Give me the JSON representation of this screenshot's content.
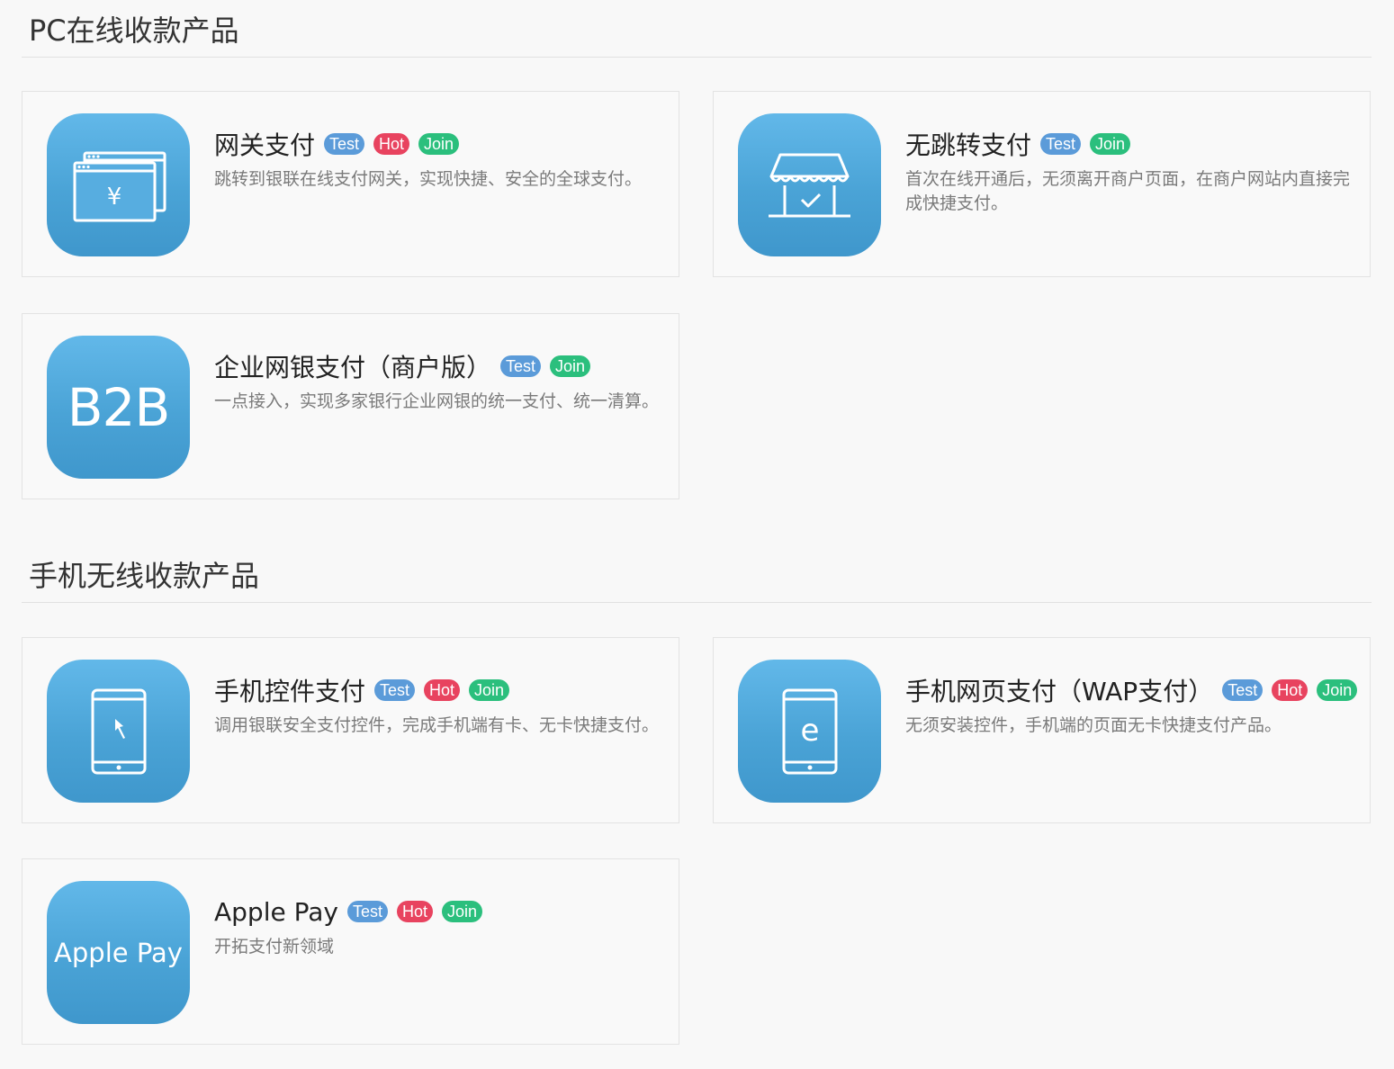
{
  "sections": [
    {
      "title": "PC在线收款产品",
      "products": [
        {
          "name": "网关支付",
          "icon": "browser-yuan-icon",
          "badges": [
            "Test",
            "Hot",
            "Join"
          ],
          "description": "跳转到银联在线支付网关，实现快捷、安全的全球支付。"
        },
        {
          "name": "无跳转支付",
          "icon": "storefront-check-icon",
          "badges": [
            "Test",
            "Join"
          ],
          "description": "首次在线开通后，无须离开商户页面，在商户网站内直接完成快捷支付。"
        },
        {
          "name": "企业网银支付（商户版）",
          "icon": "b2b-icon",
          "icon_text": "B2B",
          "badges": [
            "Test",
            "Join"
          ],
          "description": "一点接入，实现多家银行企业网银的统一支付、统一清算。"
        }
      ]
    },
    {
      "title": "手机无线收款产品",
      "products": [
        {
          "name": "手机控件支付",
          "icon": "phone-cursor-icon",
          "badges": [
            "Test",
            "Hot",
            "Join"
          ],
          "description": "调用银联安全支付控件，完成手机端有卡、无卡快捷支付。"
        },
        {
          "name": "手机网页支付（WAP支付）",
          "icon": "phone-e-icon",
          "badges": [
            "Test",
            "Hot",
            "Join"
          ],
          "description": "无须安装控件，手机端的页面无卡快捷支付产品。"
        },
        {
          "name": "Apple Pay",
          "icon": "apple-pay-icon",
          "icon_text": "Apple Pay",
          "badges": [
            "Test",
            "Hot",
            "Join"
          ],
          "description": "开拓支付新领域"
        }
      ]
    }
  ],
  "colors": {
    "badge_test": "#5b9bd9",
    "badge_hot": "#e8435f",
    "badge_join": "#2bbf7d",
    "icon_gradient_top": "#62b8e9",
    "icon_gradient_bottom": "#3f97cc"
  }
}
